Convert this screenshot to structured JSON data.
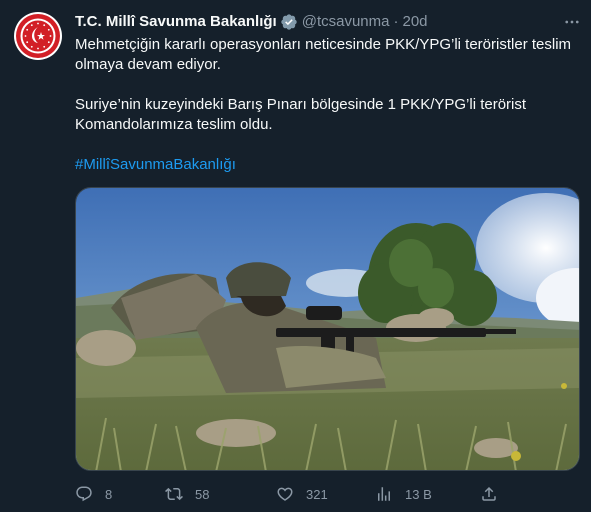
{
  "author": {
    "display_name": "T.C. Millî Savunma Bakanlığı",
    "handle": "@tcsavunma",
    "separator": "·",
    "time": "20d",
    "verified_color": "#829aab"
  },
  "tweet": {
    "paragraph1": "Mehmetçiğin kararlı operasyonları neticesinde PKK/YPG’li teröristler teslim olmaya devam ediyor.",
    "paragraph2": "Suriye’nin kuzeyindeki Barış Pınarı bölgesinde 1 PKK/YPG’li terörist Komandolarımıza teslim oldu.",
    "hashtag": "#MillîSavunmaBakanlığı",
    "hashtag_color": "#1d9bf0"
  },
  "actions": {
    "reply_count": "8",
    "retweet_count": "58",
    "like_count": "321",
    "views_count": "13 B"
  },
  "icons": {
    "more": "more-dots-icon",
    "reply": "reply-icon",
    "retweet": "retweet-icon",
    "like": "heart-icon",
    "views": "views-chart-icon",
    "share": "share-icon"
  },
  "theme": {
    "background": "#15202b",
    "text": "#f7f9f9",
    "muted": "#8b98a5",
    "avatar_red": "#d21f26"
  }
}
